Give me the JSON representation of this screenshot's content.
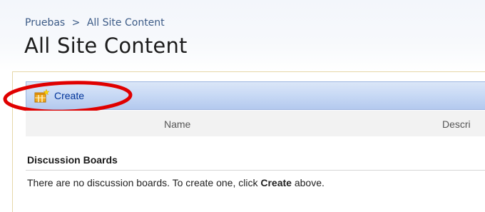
{
  "breadcrumb": {
    "items": [
      {
        "label": "Pruebas"
      },
      {
        "label": "All Site Content"
      }
    ],
    "separator": ">"
  },
  "page": {
    "title": "All Site Content"
  },
  "toolbar": {
    "create_label": "Create",
    "create_icon": "create-list-icon"
  },
  "table": {
    "columns": [
      "Name",
      "Descri"
    ]
  },
  "sections": [
    {
      "title": "Discussion Boards",
      "empty_message_before": "There are no discussion boards. To create one, click ",
      "empty_message_link": "Create",
      "empty_message_after": " above."
    }
  ],
  "colors": {
    "breadcrumb": "#3b5a86",
    "toolbar": "#c9daf5",
    "link": "#003399",
    "annotation": "#e00000"
  }
}
